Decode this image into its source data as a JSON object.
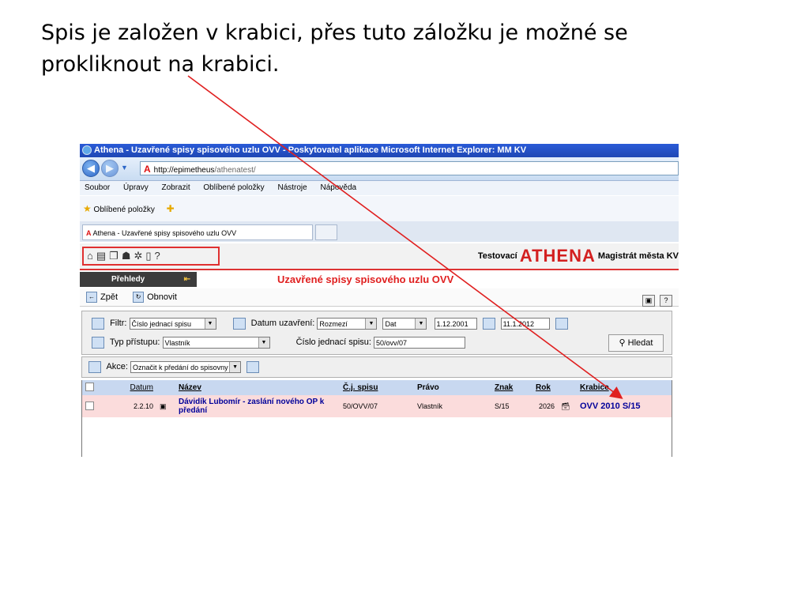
{
  "slide": {
    "caption": "Spis je založen v krabici, přes tuto záložku je možné se prokliknout na krabici."
  },
  "browser": {
    "window_title": "Athena - Uzavřené spisy spisového uzlu OVV - Poskytovatel aplikace Microsoft Internet Explorer: MM KV",
    "address_host": "http://epimetheus",
    "address_path": "/athenatest/",
    "menu": [
      "Soubor",
      "Úpravy",
      "Zobrazit",
      "Oblíbené položky",
      "Nástroje",
      "Nápověda"
    ],
    "favorites_label": "Oblíbené položky",
    "tab_label": "Athena - Uzavřené spisy spisového uzlu OVV"
  },
  "app": {
    "help_label": "?",
    "brand_prefix": "Testovací",
    "brand_name": "ATHENA",
    "brand_org": "Magistrát města KV",
    "sidebar_label": "Přehledy",
    "page_title": "Uzavřené spisy spisového uzlu OVV",
    "back_label": "Zpět",
    "refresh_label": "Obnovit",
    "filter": {
      "filtr_label": "Filtr:",
      "filtr_value": "Číslo jednací spisu",
      "datum_label": "Datum uzavření:",
      "range_value": "Rozmezí",
      "range_unit": "Dat",
      "date_from": "1.12.2001",
      "date_to": "11.1.2012",
      "typ_label": "Typ přístupu:",
      "typ_value": "Vlastník",
      "cislo_label": "Číslo jednací spisu:",
      "cislo_value": "50/ovv/07",
      "search_label": "Hledat"
    },
    "akce": {
      "label": "Akce:",
      "value": "Označit k předání do spisovny"
    },
    "table": {
      "headers": {
        "datum": "Datum",
        "nazev": "Název",
        "cj": "Č.j. spisu",
        "pravo": "Právo",
        "znak": "Znak",
        "rok": "Rok",
        "krabice": "Krabice"
      },
      "rows": [
        {
          "datum": "2.2.10",
          "nazev": "Dávidík Lubomír - zaslání nového OP k předání",
          "cj": "50/OVV/07",
          "pravo": "Vlastník",
          "znak": "S/15",
          "rok": "2026",
          "krabice": "OVV 2010 S/15"
        }
      ]
    }
  },
  "colors": {
    "arrow": "#e02020",
    "title_red": "#e02020",
    "link_blue": "#00009a",
    "row_pink": "#fbdcdc",
    "header_blue": "#c8d8f0"
  }
}
